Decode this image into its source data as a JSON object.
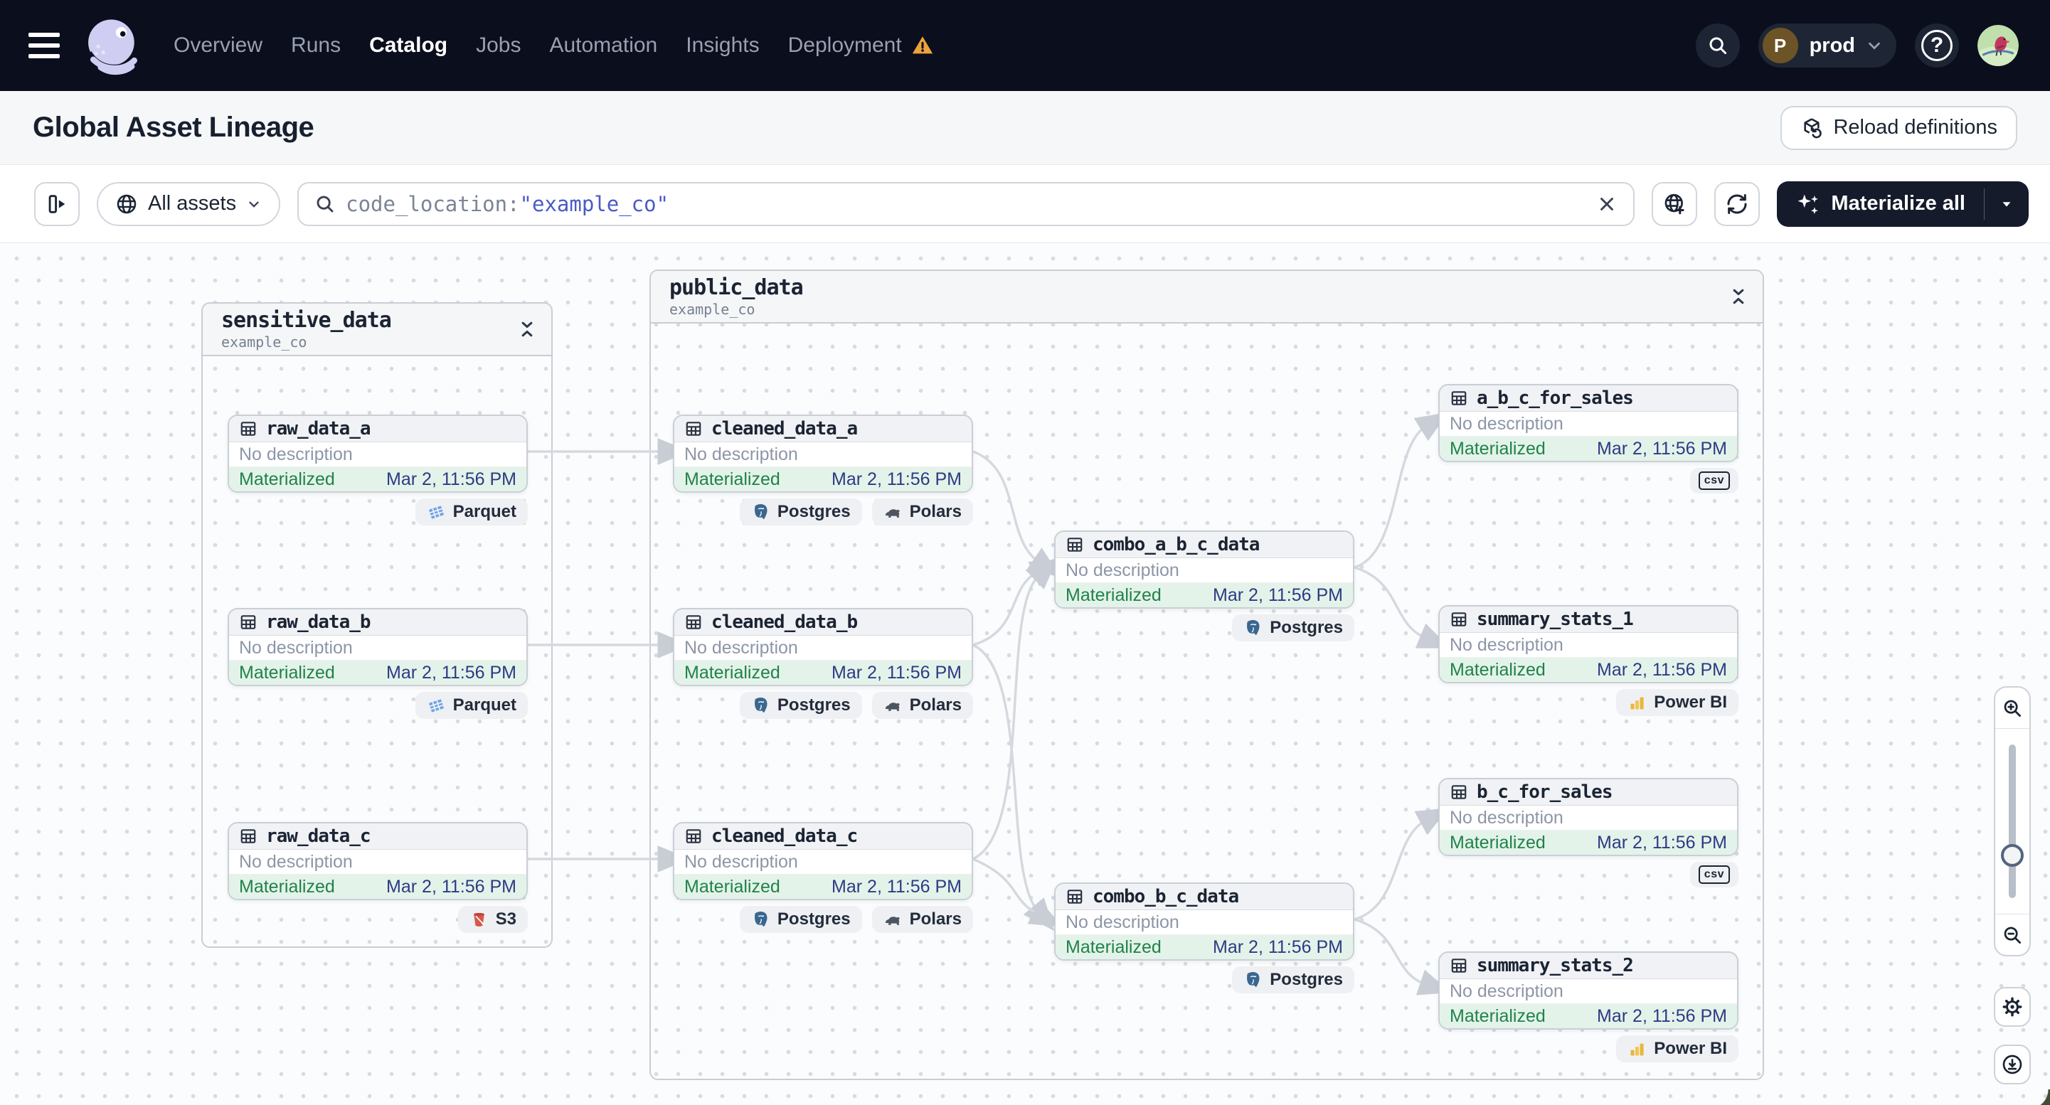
{
  "nav": {
    "items": [
      {
        "label": "Overview"
      },
      {
        "label": "Runs"
      },
      {
        "label": "Catalog"
      },
      {
        "label": "Jobs"
      },
      {
        "label": "Automation"
      },
      {
        "label": "Insights"
      },
      {
        "label": "Deployment"
      }
    ],
    "active_item": "Catalog",
    "env_initial": "P",
    "env_label": "prod",
    "help_label": "?"
  },
  "header": {
    "title": "Global Asset Lineage",
    "reload_label": "Reload definitions"
  },
  "toolbar": {
    "scope_label": "All assets",
    "search_prefix": "code_location:",
    "search_value": "\"example_co\"",
    "materialize_label": "Materialize all"
  },
  "graph": {
    "groups": [
      {
        "name": "sensitive_data",
        "subtitle": "example_co"
      },
      {
        "name": "public_data",
        "subtitle": "example_co"
      }
    ],
    "nodes": [
      {
        "label": "raw_data_a",
        "desc": "No description",
        "status": "Materialized",
        "time": "Mar 2, 11:56 PM",
        "tags": [
          "Parquet"
        ]
      },
      {
        "label": "raw_data_b",
        "desc": "No description",
        "status": "Materialized",
        "time": "Mar 2, 11:56 PM",
        "tags": [
          "Parquet"
        ]
      },
      {
        "label": "raw_data_c",
        "desc": "No description",
        "status": "Materialized",
        "time": "Mar 2, 11:56 PM",
        "tags": [
          "S3"
        ]
      },
      {
        "label": "cleaned_data_a",
        "desc": "No description",
        "status": "Materialized",
        "time": "Mar 2, 11:56 PM",
        "tags": [
          "Postgres",
          "Polars"
        ]
      },
      {
        "label": "cleaned_data_b",
        "desc": "No description",
        "status": "Materialized",
        "time": "Mar 2, 11:56 PM",
        "tags": [
          "Postgres",
          "Polars"
        ]
      },
      {
        "label": "cleaned_data_c",
        "desc": "No description",
        "status": "Materialized",
        "time": "Mar 2, 11:56 PM",
        "tags": [
          "Postgres",
          "Polars"
        ]
      },
      {
        "label": "combo_a_b_c_data",
        "desc": "No description",
        "status": "Materialized",
        "time": "Mar 2, 11:56 PM",
        "tags": [
          "Postgres"
        ]
      },
      {
        "label": "combo_b_c_data",
        "desc": "No description",
        "status": "Materialized",
        "time": "Mar 2, 11:56 PM",
        "tags": [
          "Postgres"
        ]
      },
      {
        "label": "a_b_c_for_sales",
        "desc": "No description",
        "status": "Materialized",
        "time": "Mar 2, 11:56 PM",
        "badge": "csv"
      },
      {
        "label": "summary_stats_1",
        "desc": "No description",
        "status": "Materialized",
        "time": "Mar 2, 11:56 PM",
        "tags": [
          "Power BI"
        ]
      },
      {
        "label": "b_c_for_sales",
        "desc": "No description",
        "status": "Materialized",
        "time": "Mar 2, 11:56 PM",
        "badge": "csv"
      },
      {
        "label": "summary_stats_2",
        "desc": "No description",
        "status": "Materialized",
        "time": "Mar 2, 11:56 PM",
        "tags": [
          "Power BI"
        ]
      }
    ],
    "edges": [
      {
        "from": "raw_data_a",
        "to": "cleaned_data_a"
      },
      {
        "from": "raw_data_b",
        "to": "cleaned_data_b"
      },
      {
        "from": "raw_data_c",
        "to": "cleaned_data_c"
      },
      {
        "from": "cleaned_data_a",
        "to": "combo_a_b_c_data"
      },
      {
        "from": "cleaned_data_b",
        "to": "combo_a_b_c_data"
      },
      {
        "from": "cleaned_data_c",
        "to": "combo_a_b_c_data"
      },
      {
        "from": "cleaned_data_b",
        "to": "combo_b_c_data"
      },
      {
        "from": "cleaned_data_c",
        "to": "combo_b_c_data"
      },
      {
        "from": "combo_a_b_c_data",
        "to": "a_b_c_for_sales"
      },
      {
        "from": "combo_a_b_c_data",
        "to": "summary_stats_1"
      },
      {
        "from": "combo_b_c_data",
        "to": "b_c_for_sales"
      },
      {
        "from": "combo_b_c_data",
        "to": "summary_stats_2"
      }
    ]
  },
  "controls": {
    "icons": [
      "zoom-in",
      "zoom-slider",
      "zoom-out",
      "settings",
      "download"
    ]
  }
}
